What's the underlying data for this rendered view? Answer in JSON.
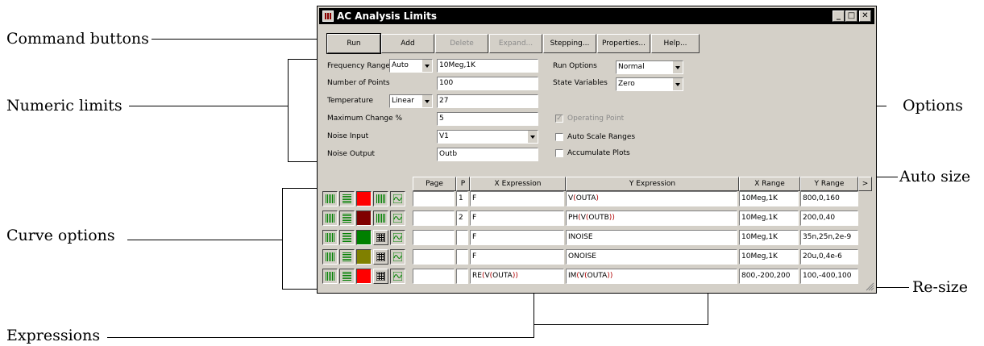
{
  "annotations": {
    "command_buttons": "Command buttons",
    "numeric_limits": "Numeric limits",
    "options": "Options",
    "auto_size": "Auto size",
    "curve_options": "Curve options",
    "re_size": "Re-size",
    "expressions": "Expressions"
  },
  "window": {
    "title": "AC Analysis Limits",
    "minimize": "_",
    "maximize": "□",
    "close": "✕"
  },
  "buttons": {
    "run": "Run",
    "add": "Add",
    "delete": "Delete",
    "expand": "Expand...",
    "stepping": "Stepping...",
    "properties": "Properties...",
    "help": "Help..."
  },
  "limits": {
    "frequency_range_label": "Frequency Range",
    "frequency_range_mode": "Auto",
    "frequency_range_value": "10Meg,1K",
    "number_of_points_label": "Number of Points",
    "number_of_points_value": "100",
    "temperature_label": "Temperature",
    "temperature_mode": "Linear",
    "temperature_value": "27",
    "maximum_change_label": "Maximum Change %",
    "maximum_change_value": "5",
    "noise_input_label": "Noise Input",
    "noise_input_value": "V1",
    "noise_output_label": "Noise Output",
    "noise_output_value": "Outb"
  },
  "options": {
    "run_options_label": "Run Options",
    "run_options_value": "Normal",
    "state_variables_label": "State Variables",
    "state_variables_value": "Zero",
    "operating_point_label": "Operating Point",
    "operating_point_checked": true,
    "operating_point_enabled": false,
    "auto_scale_label": "Auto Scale Ranges",
    "auto_scale_checked": false,
    "accumulate_label": "Accumulate Plots",
    "accumulate_checked": false
  },
  "table": {
    "headers": {
      "page": "Page",
      "p": "P",
      "x_expression": "X Expression",
      "y_expression": "Y Expression",
      "x_range": "X Range",
      "y_range": "Y Range",
      "auto_size": ">"
    },
    "rows": [
      {
        "color": "#ff0000",
        "page": "",
        "p": "1",
        "x_expr": "F",
        "y_expr": "V(OUTA)",
        "x_range": "10Meg,1K",
        "y_range": "800,0,160"
      },
      {
        "color": "#800000",
        "page": "",
        "p": "2",
        "x_expr": "F",
        "y_expr": "PH(V(OUTB))",
        "x_range": "10Meg,1K",
        "y_range": "200,0,40"
      },
      {
        "color": "#008000",
        "page": "",
        "p": "",
        "x_expr": "F",
        "y_expr": "INOISE",
        "x_range": "10Meg,1K",
        "y_range": "35n,25n,2e-9"
      },
      {
        "color": "#808000",
        "page": "",
        "p": "",
        "x_expr": "F",
        "y_expr": "ONOISE",
        "x_range": "10Meg,1K",
        "y_range": "20u,0,4e-6"
      },
      {
        "color": "#ff0000",
        "page": "",
        "p": "",
        "x_expr": "RE(V(OUTA))",
        "y_expr": "IM(V(OUTA))",
        "x_range": "800,-200,200",
        "y_range": "100,-400,100"
      }
    ]
  },
  "icons": {
    "grid_left": "vertical-grid-icon",
    "grid_mid": "horizontal-grid-icon",
    "numbers": "numbers-icon",
    "plot": "plot-icon",
    "resize": "resize-grip-icon"
  }
}
